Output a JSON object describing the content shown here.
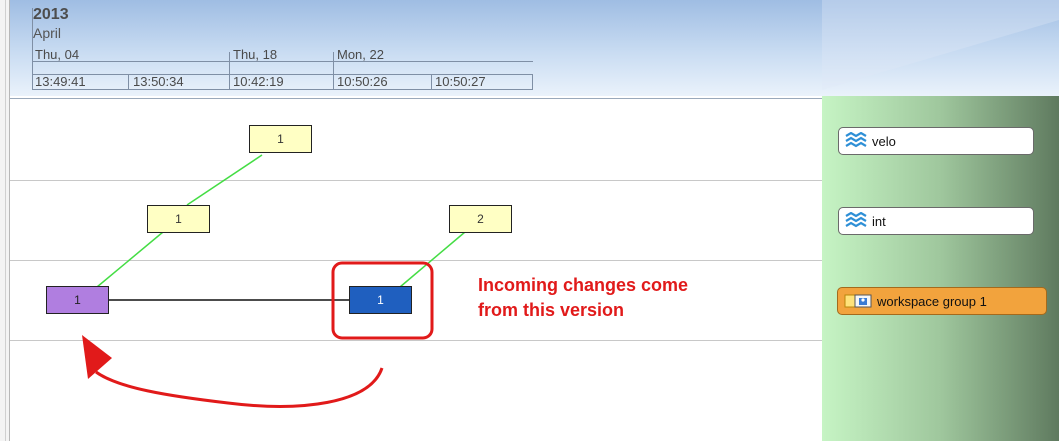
{
  "timeline": {
    "year": "2013",
    "month": "April",
    "days": [
      "Thu, 04",
      "Thu, 18",
      "Mon, 22"
    ],
    "times": [
      "13:49:41",
      "13:50:34",
      "10:42:19",
      "10:50:26",
      "10:50:27"
    ]
  },
  "branches": [
    {
      "label": "velo",
      "icon": "branch-waves-icon"
    },
    {
      "label": "int",
      "icon": "branch-waves-icon"
    },
    {
      "label": "workspace group 1",
      "icon": "workspace-group-icon"
    }
  ],
  "versions": [
    {
      "label": "1",
      "color": "yellow"
    },
    {
      "label": "1",
      "color": "yellow"
    },
    {
      "label": "2",
      "color": "yellow"
    },
    {
      "label": "1",
      "color": "purple"
    },
    {
      "label": "1",
      "color": "blue"
    }
  ],
  "annotation": {
    "text": "Incoming changes come\nfrom this version",
    "color": "#e11a1a"
  },
  "colors": {
    "header": "#9fbde3",
    "link_line": "#44dd44",
    "highlight": "#e11a1a",
    "workspace_group": "#f2a33d",
    "panel_light": "#c6f4c4",
    "panel_dark": "#5f7a5f"
  }
}
